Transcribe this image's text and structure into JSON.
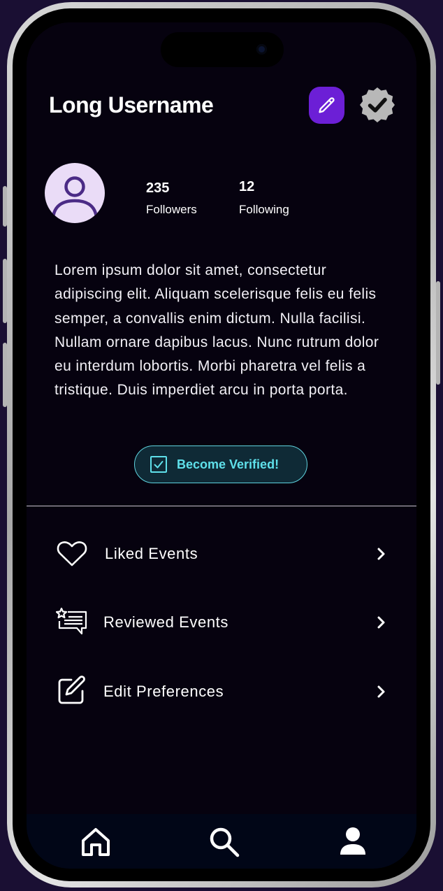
{
  "profile": {
    "username": "Long Username",
    "followers_count": "235",
    "followers_label": "Followers",
    "following_count": "12",
    "following_label": "Following",
    "bio": "Lorem ipsum dolor sit amet, consectetur adipiscing elit. Aliquam scelerisque felis eu felis semper, a convallis enim dictum. Nulla facilisi. Nullam ornare dapibus lacus. Nunc rutrum dolor eu interdum lobortis. Morbi pharetra vel felis a tristique. Duis imperdiet arcu in porta porta."
  },
  "verify_button": {
    "label": "Become Verified!"
  },
  "menu": {
    "items": [
      {
        "label": "Liked Events",
        "icon": "heart-icon"
      },
      {
        "label": "Reviewed Events",
        "icon": "review-icon"
      },
      {
        "label": "Edit Preferences",
        "icon": "edit-square-icon"
      }
    ]
  },
  "nav": {
    "items": [
      {
        "name": "home",
        "icon": "home-icon"
      },
      {
        "name": "search",
        "icon": "search-icon"
      },
      {
        "name": "profile",
        "icon": "person-icon"
      }
    ]
  },
  "colors": {
    "background": "#06020f",
    "accent": "#6c1fd6",
    "verify_accent": "#5fe0ea",
    "badge_gray": "#b8b8b8"
  }
}
